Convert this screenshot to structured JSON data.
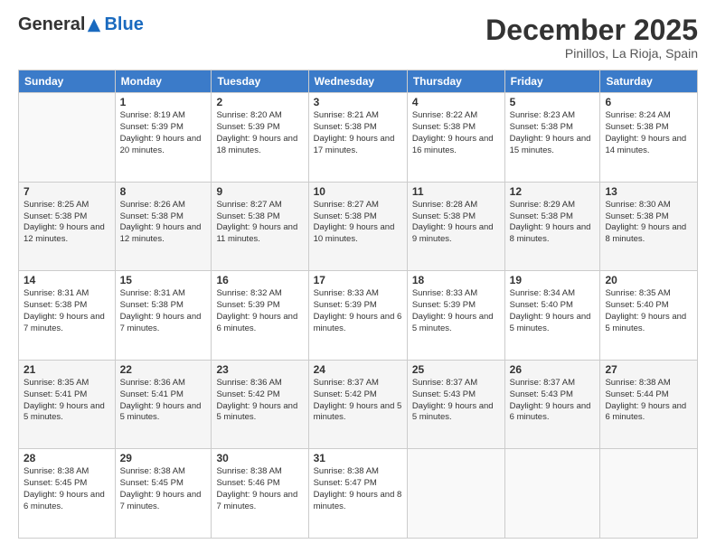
{
  "logo": {
    "general": "General",
    "blue": "Blue"
  },
  "title": "December 2025",
  "subtitle": "Pinillos, La Rioja, Spain",
  "weekdays": [
    "Sunday",
    "Monday",
    "Tuesday",
    "Wednesday",
    "Thursday",
    "Friday",
    "Saturday"
  ],
  "weeks": [
    [
      {
        "day": "",
        "info": ""
      },
      {
        "day": "1",
        "info": "Sunrise: 8:19 AM\nSunset: 5:39 PM\nDaylight: 9 hours\nand 20 minutes."
      },
      {
        "day": "2",
        "info": "Sunrise: 8:20 AM\nSunset: 5:39 PM\nDaylight: 9 hours\nand 18 minutes."
      },
      {
        "day": "3",
        "info": "Sunrise: 8:21 AM\nSunset: 5:38 PM\nDaylight: 9 hours\nand 17 minutes."
      },
      {
        "day": "4",
        "info": "Sunrise: 8:22 AM\nSunset: 5:38 PM\nDaylight: 9 hours\nand 16 minutes."
      },
      {
        "day": "5",
        "info": "Sunrise: 8:23 AM\nSunset: 5:38 PM\nDaylight: 9 hours\nand 15 minutes."
      },
      {
        "day": "6",
        "info": "Sunrise: 8:24 AM\nSunset: 5:38 PM\nDaylight: 9 hours\nand 14 minutes."
      }
    ],
    [
      {
        "day": "7",
        "info": "Sunrise: 8:25 AM\nSunset: 5:38 PM\nDaylight: 9 hours\nand 12 minutes."
      },
      {
        "day": "8",
        "info": "Sunrise: 8:26 AM\nSunset: 5:38 PM\nDaylight: 9 hours\nand 12 minutes."
      },
      {
        "day": "9",
        "info": "Sunrise: 8:27 AM\nSunset: 5:38 PM\nDaylight: 9 hours\nand 11 minutes."
      },
      {
        "day": "10",
        "info": "Sunrise: 8:27 AM\nSunset: 5:38 PM\nDaylight: 9 hours\nand 10 minutes."
      },
      {
        "day": "11",
        "info": "Sunrise: 8:28 AM\nSunset: 5:38 PM\nDaylight: 9 hours\nand 9 minutes."
      },
      {
        "day": "12",
        "info": "Sunrise: 8:29 AM\nSunset: 5:38 PM\nDaylight: 9 hours\nand 8 minutes."
      },
      {
        "day": "13",
        "info": "Sunrise: 8:30 AM\nSunset: 5:38 PM\nDaylight: 9 hours\nand 8 minutes."
      }
    ],
    [
      {
        "day": "14",
        "info": "Sunrise: 8:31 AM\nSunset: 5:38 PM\nDaylight: 9 hours\nand 7 minutes."
      },
      {
        "day": "15",
        "info": "Sunrise: 8:31 AM\nSunset: 5:38 PM\nDaylight: 9 hours\nand 7 minutes."
      },
      {
        "day": "16",
        "info": "Sunrise: 8:32 AM\nSunset: 5:39 PM\nDaylight: 9 hours\nand 6 minutes."
      },
      {
        "day": "17",
        "info": "Sunrise: 8:33 AM\nSunset: 5:39 PM\nDaylight: 9 hours\nand 6 minutes."
      },
      {
        "day": "18",
        "info": "Sunrise: 8:33 AM\nSunset: 5:39 PM\nDaylight: 9 hours\nand 5 minutes."
      },
      {
        "day": "19",
        "info": "Sunrise: 8:34 AM\nSunset: 5:40 PM\nDaylight: 9 hours\nand 5 minutes."
      },
      {
        "day": "20",
        "info": "Sunrise: 8:35 AM\nSunset: 5:40 PM\nDaylight: 9 hours\nand 5 minutes."
      }
    ],
    [
      {
        "day": "21",
        "info": "Sunrise: 8:35 AM\nSunset: 5:41 PM\nDaylight: 9 hours\nand 5 minutes."
      },
      {
        "day": "22",
        "info": "Sunrise: 8:36 AM\nSunset: 5:41 PM\nDaylight: 9 hours\nand 5 minutes."
      },
      {
        "day": "23",
        "info": "Sunrise: 8:36 AM\nSunset: 5:42 PM\nDaylight: 9 hours\nand 5 minutes."
      },
      {
        "day": "24",
        "info": "Sunrise: 8:37 AM\nSunset: 5:42 PM\nDaylight: 9 hours\nand 5 minutes."
      },
      {
        "day": "25",
        "info": "Sunrise: 8:37 AM\nSunset: 5:43 PM\nDaylight: 9 hours\nand 5 minutes."
      },
      {
        "day": "26",
        "info": "Sunrise: 8:37 AM\nSunset: 5:43 PM\nDaylight: 9 hours\nand 6 minutes."
      },
      {
        "day": "27",
        "info": "Sunrise: 8:38 AM\nSunset: 5:44 PM\nDaylight: 9 hours\nand 6 minutes."
      }
    ],
    [
      {
        "day": "28",
        "info": "Sunrise: 8:38 AM\nSunset: 5:45 PM\nDaylight: 9 hours\nand 6 minutes."
      },
      {
        "day": "29",
        "info": "Sunrise: 8:38 AM\nSunset: 5:45 PM\nDaylight: 9 hours\nand 7 minutes."
      },
      {
        "day": "30",
        "info": "Sunrise: 8:38 AM\nSunset: 5:46 PM\nDaylight: 9 hours\nand 7 minutes."
      },
      {
        "day": "31",
        "info": "Sunrise: 8:38 AM\nSunset: 5:47 PM\nDaylight: 9 hours\nand 8 minutes."
      },
      {
        "day": "",
        "info": ""
      },
      {
        "day": "",
        "info": ""
      },
      {
        "day": "",
        "info": ""
      }
    ]
  ]
}
